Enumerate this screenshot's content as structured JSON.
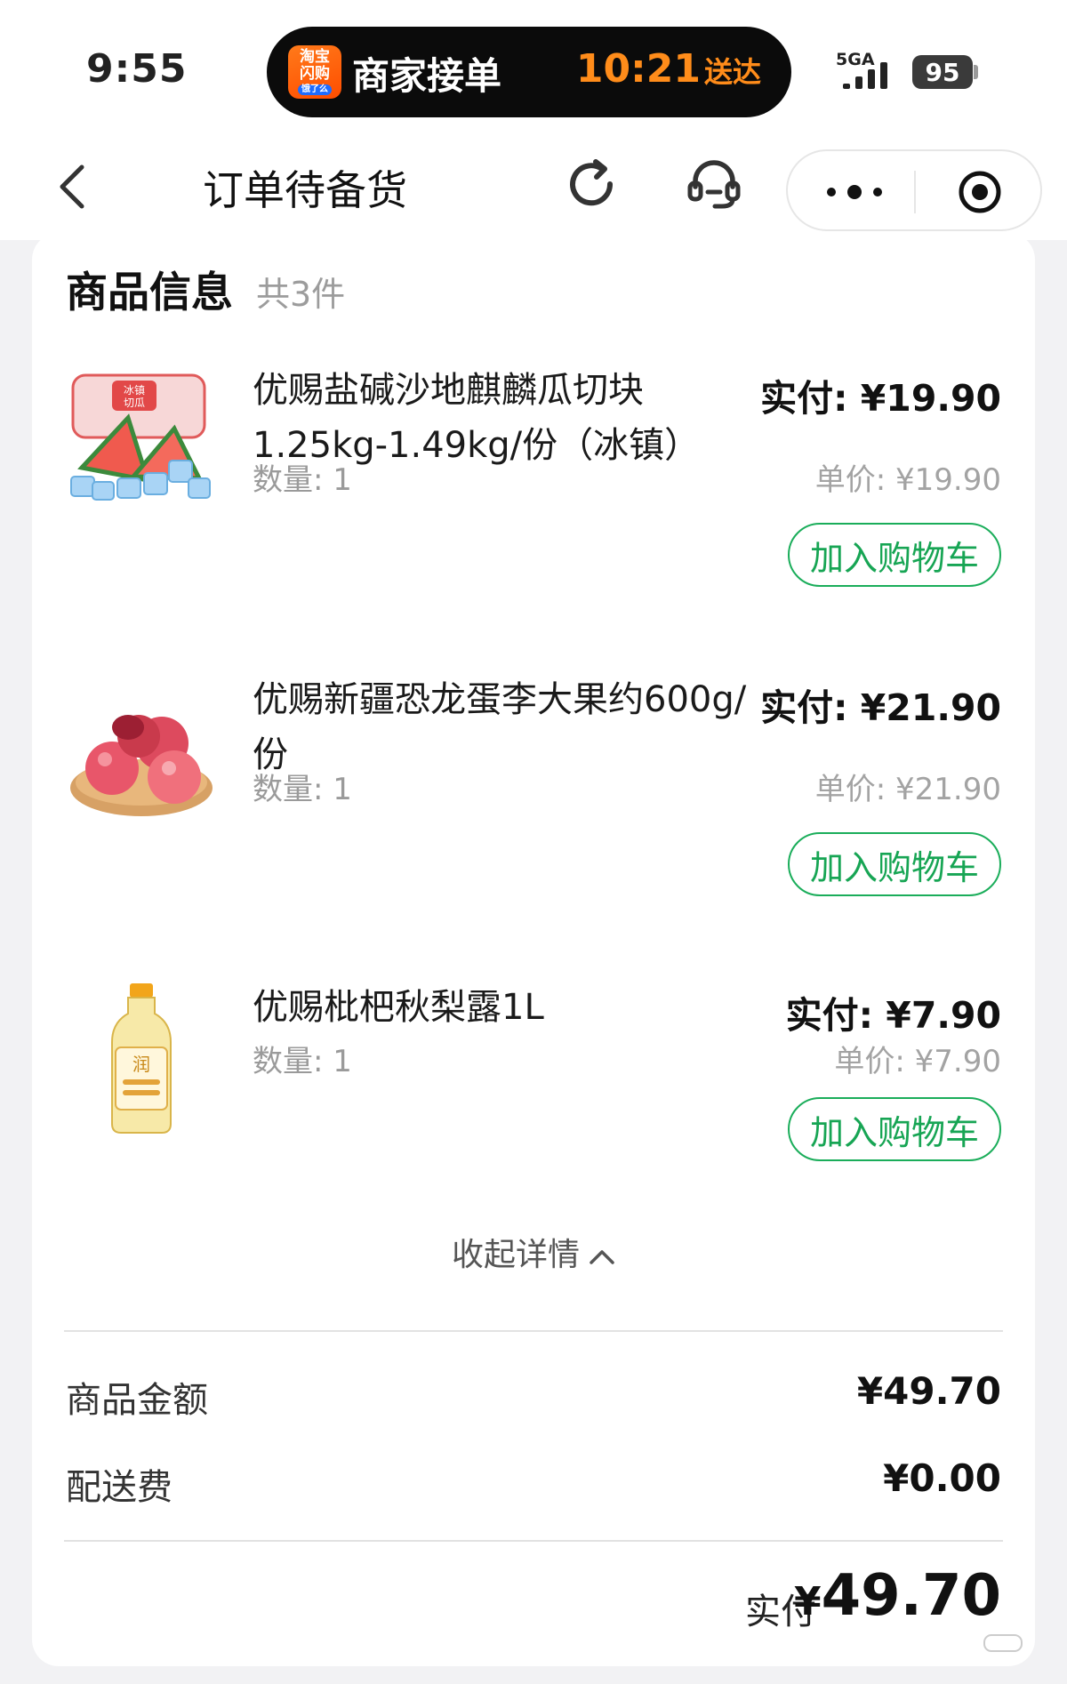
{
  "status_bar": {
    "time": "9:55",
    "app_logo_text": "淘宝\n闪购",
    "app_logo_sub": "饿了么",
    "live_activity_title": "商家接单",
    "eta_time": "10:21",
    "eta_suffix": "送达",
    "network": "5GA",
    "battery": "95"
  },
  "nav": {
    "title": "订单待备货",
    "icons": [
      "back-icon",
      "refresh-icon",
      "customer-service-icon",
      "more-icon",
      "close-miniapp-icon"
    ]
  },
  "goods": {
    "title": "商品信息",
    "count": "共3件",
    "items": [
      {
        "name": "优赐盐碱沙地麒麟瓜切块1.25kg-1.49kg/份（冰镇）",
        "quantity": "数量: 1",
        "paid": "实付: ¥19.90",
        "unit_price": "单价: ¥19.90",
        "cart_button": "加入购物车",
        "image": "watermelon-image"
      },
      {
        "name": "优赐新疆恐龙蛋李大果约600g/份",
        "quantity": "数量: 1",
        "paid": "实付: ¥21.90",
        "unit_price": "单价: ¥21.90",
        "cart_button": "加入购物车",
        "image": "plum-image"
      },
      {
        "name": "优赐枇杷秋梨露1L",
        "quantity": "数量: 1",
        "paid": "实付: ¥7.90",
        "unit_price": "单价: ¥7.90",
        "cart_button": "加入购物车",
        "image": "pear-drink-bottle-image"
      }
    ],
    "collapse_label": "收起详情"
  },
  "summary": {
    "goods_amount_label": "商品金额",
    "goods_amount": "¥49.70",
    "delivery_fee_label": "配送费",
    "delivery_fee": "¥0.00",
    "total_label": "实付",
    "total_currency": "¥",
    "total_value": "49.70"
  },
  "colors": {
    "accent_green": "#17a554",
    "eta_orange": "#ff8c1a",
    "app_orange": "#ff5a00"
  }
}
